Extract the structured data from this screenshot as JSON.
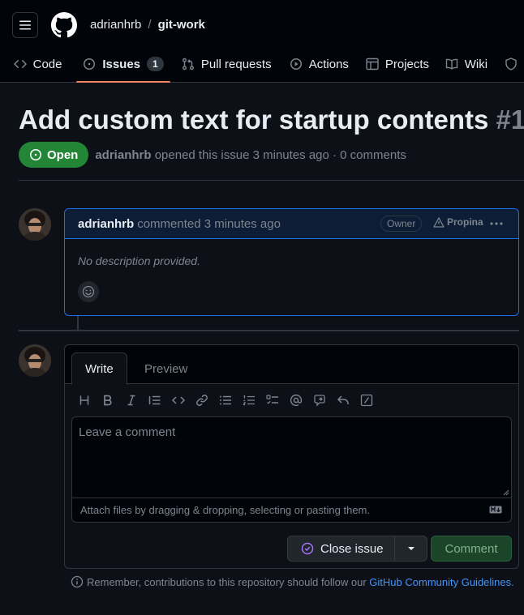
{
  "header": {
    "owner": "adrianhrb",
    "separator": "/",
    "repo": "git-work"
  },
  "tabs": [
    {
      "label": "Code",
      "icon": "code-icon"
    },
    {
      "label": "Issues",
      "icon": "issue-opened-icon",
      "count": "1",
      "active": true
    },
    {
      "label": "Pull requests",
      "icon": "git-pull-request-icon"
    },
    {
      "label": "Actions",
      "icon": "play-icon"
    },
    {
      "label": "Projects",
      "icon": "table-icon"
    },
    {
      "label": "Wiki",
      "icon": "book-icon"
    }
  ],
  "issue": {
    "title": "Add custom text for startup contents",
    "number": "#1",
    "state": "Open",
    "author": "adrianhrb",
    "meta_text": "opened this issue 3 minutes ago · 0 comments"
  },
  "comment": {
    "author": "adrianhrb",
    "time": "commented 3 minutes ago",
    "role_badge": "Owner",
    "propina": "Propina",
    "body": "No description provided."
  },
  "editor": {
    "tab_write": "Write",
    "tab_preview": "Preview",
    "placeholder": "Leave a comment",
    "attach_hint": "Attach files by dragging & dropping, selecting or pasting them.",
    "close_button": "Close issue",
    "comment_button": "Comment"
  },
  "footer": {
    "text": "Remember, contributions to this repository should follow our",
    "link": "GitHub Community Guidelines",
    "period": "."
  },
  "colors": {
    "background": "#0d1117",
    "header_bg": "#010409",
    "accent_underline": "#f78166",
    "open_green": "#238636",
    "link_blue": "#4493f8",
    "comment_border": "#1f6feb"
  }
}
